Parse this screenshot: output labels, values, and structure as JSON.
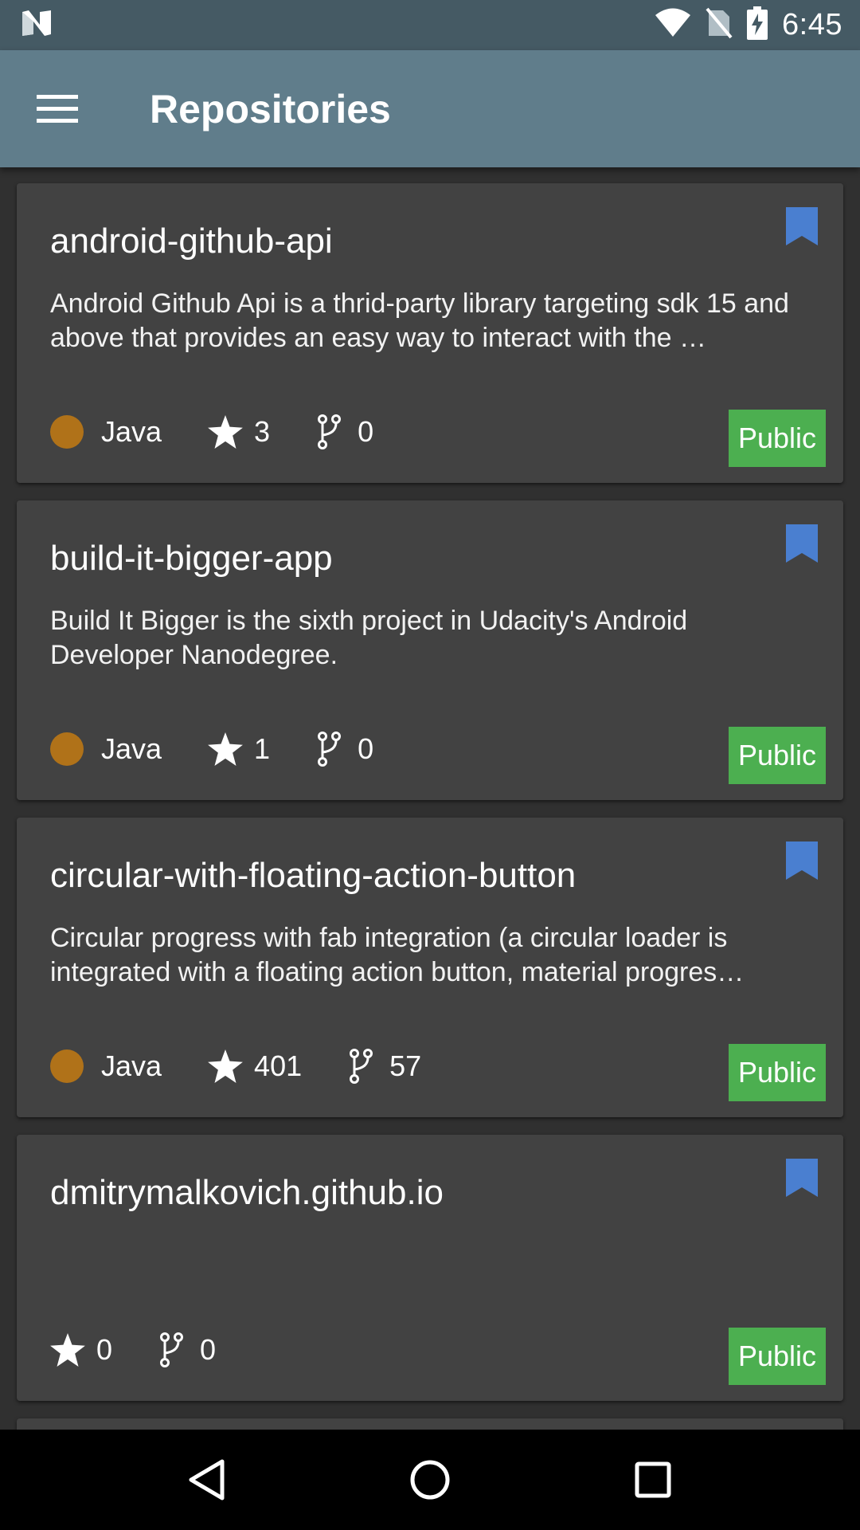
{
  "status_bar": {
    "time": "6:45",
    "icons": [
      "notification-n-icon",
      "wifi-icon",
      "no-sim-icon",
      "battery-charging-icon"
    ]
  },
  "app_bar": {
    "title": "Repositories",
    "menu_icon": "hamburger-menu-icon"
  },
  "colors": {
    "status_bar": "#455a64",
    "app_bar": "#607d8b",
    "background": "#303030",
    "card": "#424242",
    "bookmark": "#4a7fd0",
    "public_badge": "#4caf50",
    "java_dot": "#b07219"
  },
  "repos": [
    {
      "name": "android-github-api",
      "description": "Android Github Api is a thrid-party library targeting sdk 15 and above that provides an easy way to interact with the …",
      "language": "Java",
      "stars": "3",
      "forks": "0",
      "visibility": "Public"
    },
    {
      "name": "build-it-bigger-app",
      "description": "Build It Bigger is the sixth project in Udacity's Android Developer Nanodegree.",
      "language": "Java",
      "stars": "1",
      "forks": "0",
      "visibility": "Public"
    },
    {
      "name": "circular-with-floating-action-button",
      "description": "Circular progress with fab integration (a circular loader is integrated with a floating action button, material progres…",
      "language": "Java",
      "stars": "401",
      "forks": "57",
      "visibility": "Public"
    },
    {
      "name": "dmitrymalkovich.github.io",
      "description": "",
      "language": "",
      "stars": "0",
      "forks": "0",
      "visibility": "Public"
    }
  ],
  "nav_bar": {
    "icons": [
      "back-icon",
      "home-icon",
      "recents-icon"
    ]
  }
}
